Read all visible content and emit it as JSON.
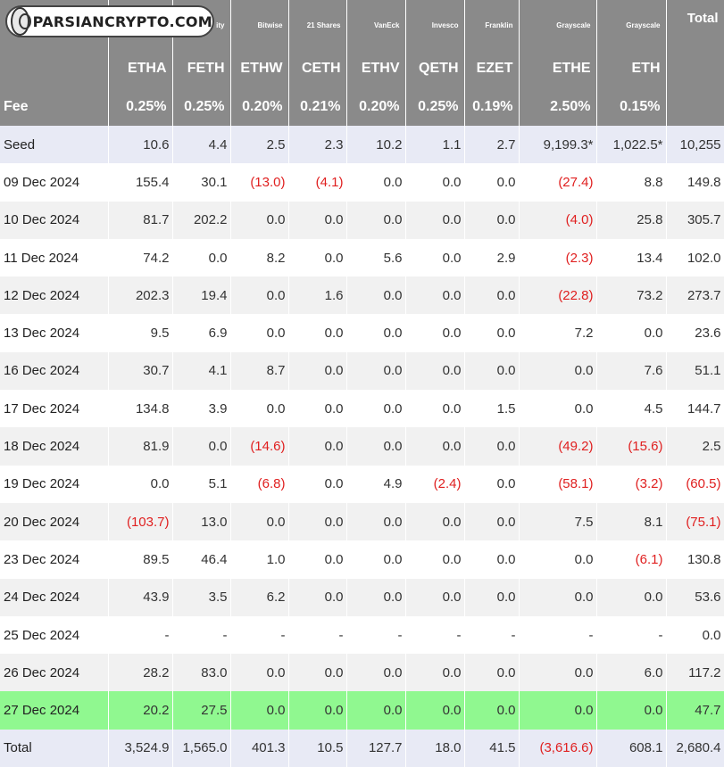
{
  "logo": {
    "text": "PARSIANCRYPTO.COM"
  },
  "header": {
    "issuers": [
      "",
      "",
      "ity",
      "Bitwise",
      "21 Shares",
      "VanEck",
      "Invesco",
      "Franklin",
      "Grayscale",
      "Grayscale",
      "Total"
    ],
    "tickers": [
      "",
      "ETHA",
      "FETH",
      "ETHW",
      "CETH",
      "ETHV",
      "QETH",
      "EZET",
      "ETHE",
      "ETH",
      ""
    ],
    "fee_label": "Fee",
    "fees": [
      "0.25%",
      "0.25%",
      "0.20%",
      "0.21%",
      "0.20%",
      "0.25%",
      "0.19%",
      "2.50%",
      "0.15%",
      ""
    ]
  },
  "rows": [
    {
      "label": "Seed",
      "style": "seed",
      "cells": [
        "10.6",
        "4.4",
        "2.5",
        "2.3",
        "10.2",
        "1.1",
        "2.7",
        "9,199.3*",
        "1,022.5*",
        "10,255"
      ],
      "neg": []
    },
    {
      "label": "09 Dec 2024",
      "style": "white",
      "cells": [
        "155.4",
        "30.1",
        "(13.0)",
        "(4.1)",
        "0.0",
        "0.0",
        "0.0",
        "(27.4)",
        "8.8",
        "149.8"
      ],
      "neg": [
        2,
        3,
        7
      ]
    },
    {
      "label": "10 Dec 2024",
      "style": "grey",
      "cells": [
        "81.7",
        "202.2",
        "0.0",
        "0.0",
        "0.0",
        "0.0",
        "0.0",
        "(4.0)",
        "25.8",
        "305.7"
      ],
      "neg": [
        7
      ]
    },
    {
      "label": "11 Dec 2024",
      "style": "white",
      "cells": [
        "74.2",
        "0.0",
        "8.2",
        "0.0",
        "5.6",
        "0.0",
        "2.9",
        "(2.3)",
        "13.4",
        "102.0"
      ],
      "neg": [
        7
      ]
    },
    {
      "label": "12 Dec 2024",
      "style": "grey",
      "cells": [
        "202.3",
        "19.4",
        "0.0",
        "1.6",
        "0.0",
        "0.0",
        "0.0",
        "(22.8)",
        "73.2",
        "273.7"
      ],
      "neg": [
        7
      ]
    },
    {
      "label": "13 Dec 2024",
      "style": "white",
      "cells": [
        "9.5",
        "6.9",
        "0.0",
        "0.0",
        "0.0",
        "0.0",
        "0.0",
        "7.2",
        "0.0",
        "23.6"
      ],
      "neg": []
    },
    {
      "label": "16 Dec 2024",
      "style": "grey",
      "cells": [
        "30.7",
        "4.1",
        "8.7",
        "0.0",
        "0.0",
        "0.0",
        "0.0",
        "0.0",
        "7.6",
        "51.1"
      ],
      "neg": []
    },
    {
      "label": "17 Dec 2024",
      "style": "white",
      "cells": [
        "134.8",
        "3.9",
        "0.0",
        "0.0",
        "0.0",
        "0.0",
        "1.5",
        "0.0",
        "4.5",
        "144.7"
      ],
      "neg": []
    },
    {
      "label": "18 Dec 2024",
      "style": "grey",
      "cells": [
        "81.9",
        "0.0",
        "(14.6)",
        "0.0",
        "0.0",
        "0.0",
        "0.0",
        "(49.2)",
        "(15.6)",
        "2.5"
      ],
      "neg": [
        2,
        7,
        8
      ]
    },
    {
      "label": "19 Dec 2024",
      "style": "white",
      "cells": [
        "0.0",
        "5.1",
        "(6.8)",
        "0.0",
        "4.9",
        "(2.4)",
        "0.0",
        "(58.1)",
        "(3.2)",
        "(60.5)"
      ],
      "neg": [
        2,
        5,
        7,
        8,
        9
      ]
    },
    {
      "label": "20 Dec 2024",
      "style": "grey",
      "cells": [
        "(103.7)",
        "13.0",
        "0.0",
        "0.0",
        "0.0",
        "0.0",
        "0.0",
        "7.5",
        "8.1",
        "(75.1)"
      ],
      "neg": [
        0,
        9
      ]
    },
    {
      "label": "23 Dec 2024",
      "style": "white",
      "cells": [
        "89.5",
        "46.4",
        "1.0",
        "0.0",
        "0.0",
        "0.0",
        "0.0",
        "0.0",
        "(6.1)",
        "130.8"
      ],
      "neg": [
        8
      ]
    },
    {
      "label": "24 Dec 2024",
      "style": "grey",
      "cells": [
        "43.9",
        "3.5",
        "6.2",
        "0.0",
        "0.0",
        "0.0",
        "0.0",
        "0.0",
        "0.0",
        "53.6"
      ],
      "neg": []
    },
    {
      "label": "25 Dec 2024",
      "style": "white",
      "cells": [
        "-",
        "-",
        "-",
        "-",
        "-",
        "-",
        "-",
        "-",
        "-",
        "0.0"
      ],
      "neg": []
    },
    {
      "label": "26 Dec 2024",
      "style": "grey",
      "cells": [
        "28.2",
        "83.0",
        "0.0",
        "0.0",
        "0.0",
        "0.0",
        "0.0",
        "0.0",
        "6.0",
        "117.2"
      ],
      "neg": []
    },
    {
      "label": "27 Dec 2024",
      "style": "hl",
      "cells": [
        "20.2",
        "27.5",
        "0.0",
        "0.0",
        "0.0",
        "0.0",
        "0.0",
        "0.0",
        "0.0",
        "47.7"
      ],
      "neg": []
    },
    {
      "label": "Total",
      "style": "total",
      "cells": [
        "3,524.9",
        "1,565.0",
        "401.3",
        "10.5",
        "127.7",
        "18.0",
        "41.5",
        "(3,616.6)",
        "608.1",
        "2,680.4"
      ],
      "neg": [
        7
      ]
    }
  ]
}
